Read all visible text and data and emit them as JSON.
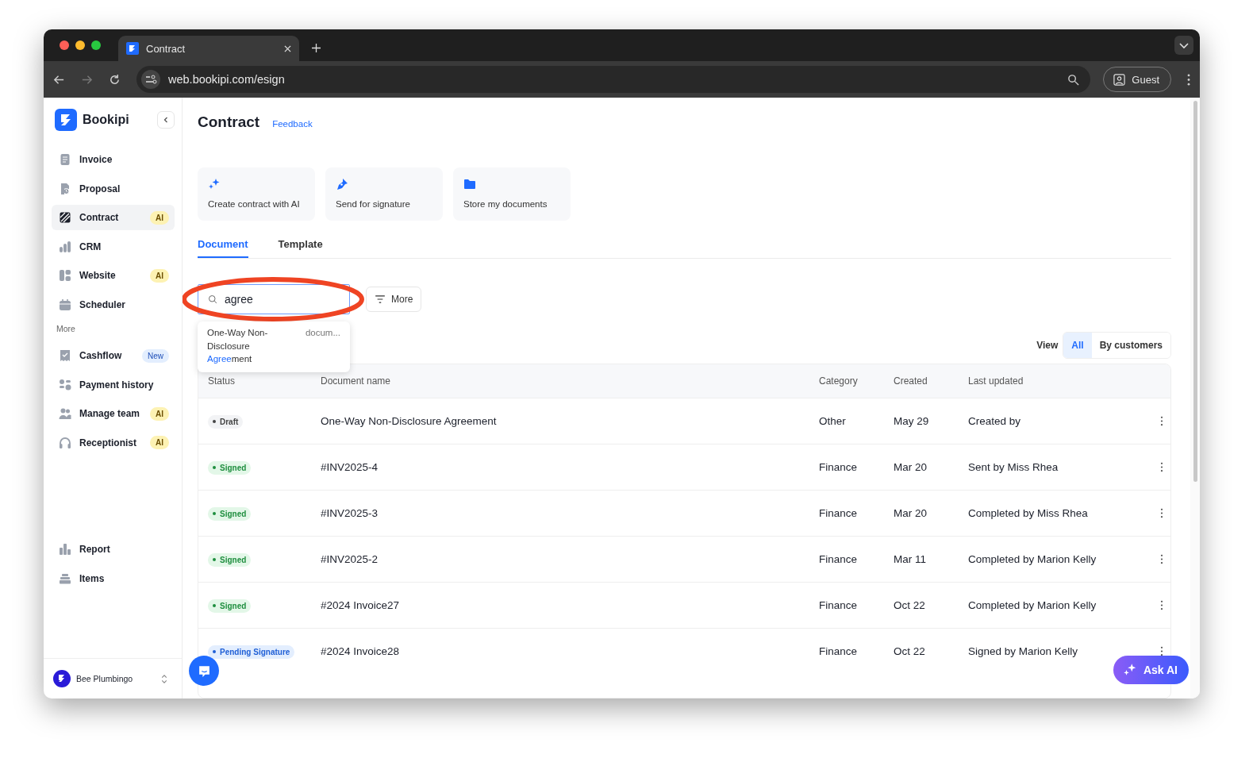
{
  "browser": {
    "tab_title": "Contract",
    "url": "web.bookipi.com/esign",
    "profile": "Guest"
  },
  "sidebar": {
    "brand": "Bookipi",
    "items": [
      {
        "label": "Invoice",
        "selected": false
      },
      {
        "label": "Proposal",
        "selected": false
      },
      {
        "label": "Contract",
        "selected": true,
        "badge": {
          "text": "AI",
          "kind": "ai"
        }
      },
      {
        "label": "CRM",
        "selected": false
      },
      {
        "label": "Website",
        "selected": false,
        "badge": {
          "text": "AI",
          "kind": "ai"
        }
      },
      {
        "label": "Scheduler",
        "selected": false
      }
    ],
    "section_label": "More",
    "more_items": [
      {
        "label": "Cashflow",
        "selected": false,
        "badge": {
          "text": "New",
          "kind": "new"
        }
      },
      {
        "label": "Payment history",
        "selected": false
      },
      {
        "label": "Manage team",
        "selected": false,
        "badge": {
          "text": "AI",
          "kind": "ai"
        }
      },
      {
        "label": "Receptionist",
        "selected": false,
        "badge": {
          "text": "AI",
          "kind": "ai"
        }
      }
    ],
    "bottom_items": [
      {
        "label": "Report",
        "selected": false
      },
      {
        "label": "Items",
        "selected": false
      }
    ],
    "account": "Bee Plumbingo"
  },
  "page": {
    "title": "Contract",
    "feedback": "Feedback",
    "actions": [
      {
        "label": "Create contract with AI"
      },
      {
        "label": "Send for signature"
      },
      {
        "label": "Store my documents"
      }
    ],
    "tabs": [
      {
        "label": "Document",
        "selected": true
      },
      {
        "label": "Template",
        "selected": false
      }
    ],
    "search": {
      "value": "agree"
    },
    "filter_button": "More",
    "suggestion": {
      "before": "One-Way Non-Disclosure ",
      "match": "Agree",
      "after": "ment",
      "type": "docum..."
    },
    "view_label": "View",
    "view_options": [
      {
        "label": "All",
        "selected": true
      },
      {
        "label": "By customers",
        "selected": false
      }
    ],
    "columns": [
      "Status",
      "Document name",
      "Category",
      "Created",
      "Last updated"
    ],
    "rows": [
      {
        "status": {
          "label": "Draft",
          "kind": "draft"
        },
        "name": "One-Way Non-Disclosure Agreement",
        "category": "Other",
        "created": "May 29",
        "updated": "Created by"
      },
      {
        "status": {
          "label": "Signed",
          "kind": "signed"
        },
        "name": "#INV2025-4",
        "category": "Finance",
        "created": "Mar 20",
        "updated": "Sent by Miss Rhea"
      },
      {
        "status": {
          "label": "Signed",
          "kind": "signed"
        },
        "name": "#INV2025-3",
        "category": "Finance",
        "created": "Mar 20",
        "updated": "Completed by Miss Rhea"
      },
      {
        "status": {
          "label": "Signed",
          "kind": "signed"
        },
        "name": "#INV2025-2",
        "category": "Finance",
        "created": "Mar 11",
        "updated": "Completed by Marion Kelly"
      },
      {
        "status": {
          "label": "Signed",
          "kind": "signed"
        },
        "name": "#2024 Invoice27",
        "category": "Finance",
        "created": "Oct 22",
        "updated": "Completed by Marion Kelly"
      },
      {
        "status": {
          "label": "Pending Signature",
          "kind": "pending"
        },
        "name": "#2024 Invoice28",
        "category": "Finance",
        "created": "Oct 22",
        "updated": "Signed by Marion Kelly"
      }
    ],
    "ask_ai": "Ask AI"
  }
}
